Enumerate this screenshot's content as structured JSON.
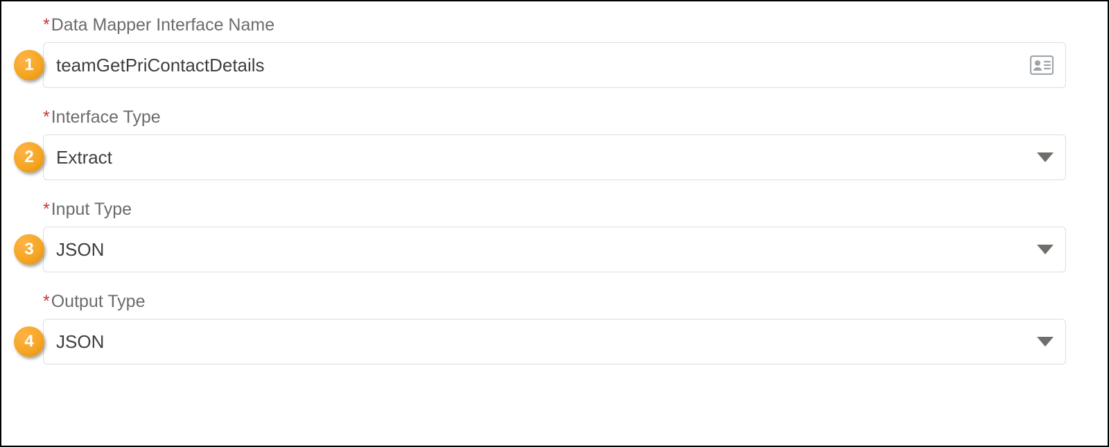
{
  "fields": [
    {
      "badge": "1",
      "label": "Data Mapper Interface Name",
      "value": "teamGetPriContactDetails",
      "type": "text",
      "icon": "contact-card-icon"
    },
    {
      "badge": "2",
      "label": "Interface Type",
      "value": "Extract",
      "type": "select"
    },
    {
      "badge": "3",
      "label": "Input Type",
      "value": "JSON",
      "type": "select"
    },
    {
      "badge": "4",
      "label": "Output Type",
      "value": "JSON",
      "type": "select"
    }
  ],
  "colors": {
    "required": "#c23934",
    "badge": "#f5a623"
  }
}
